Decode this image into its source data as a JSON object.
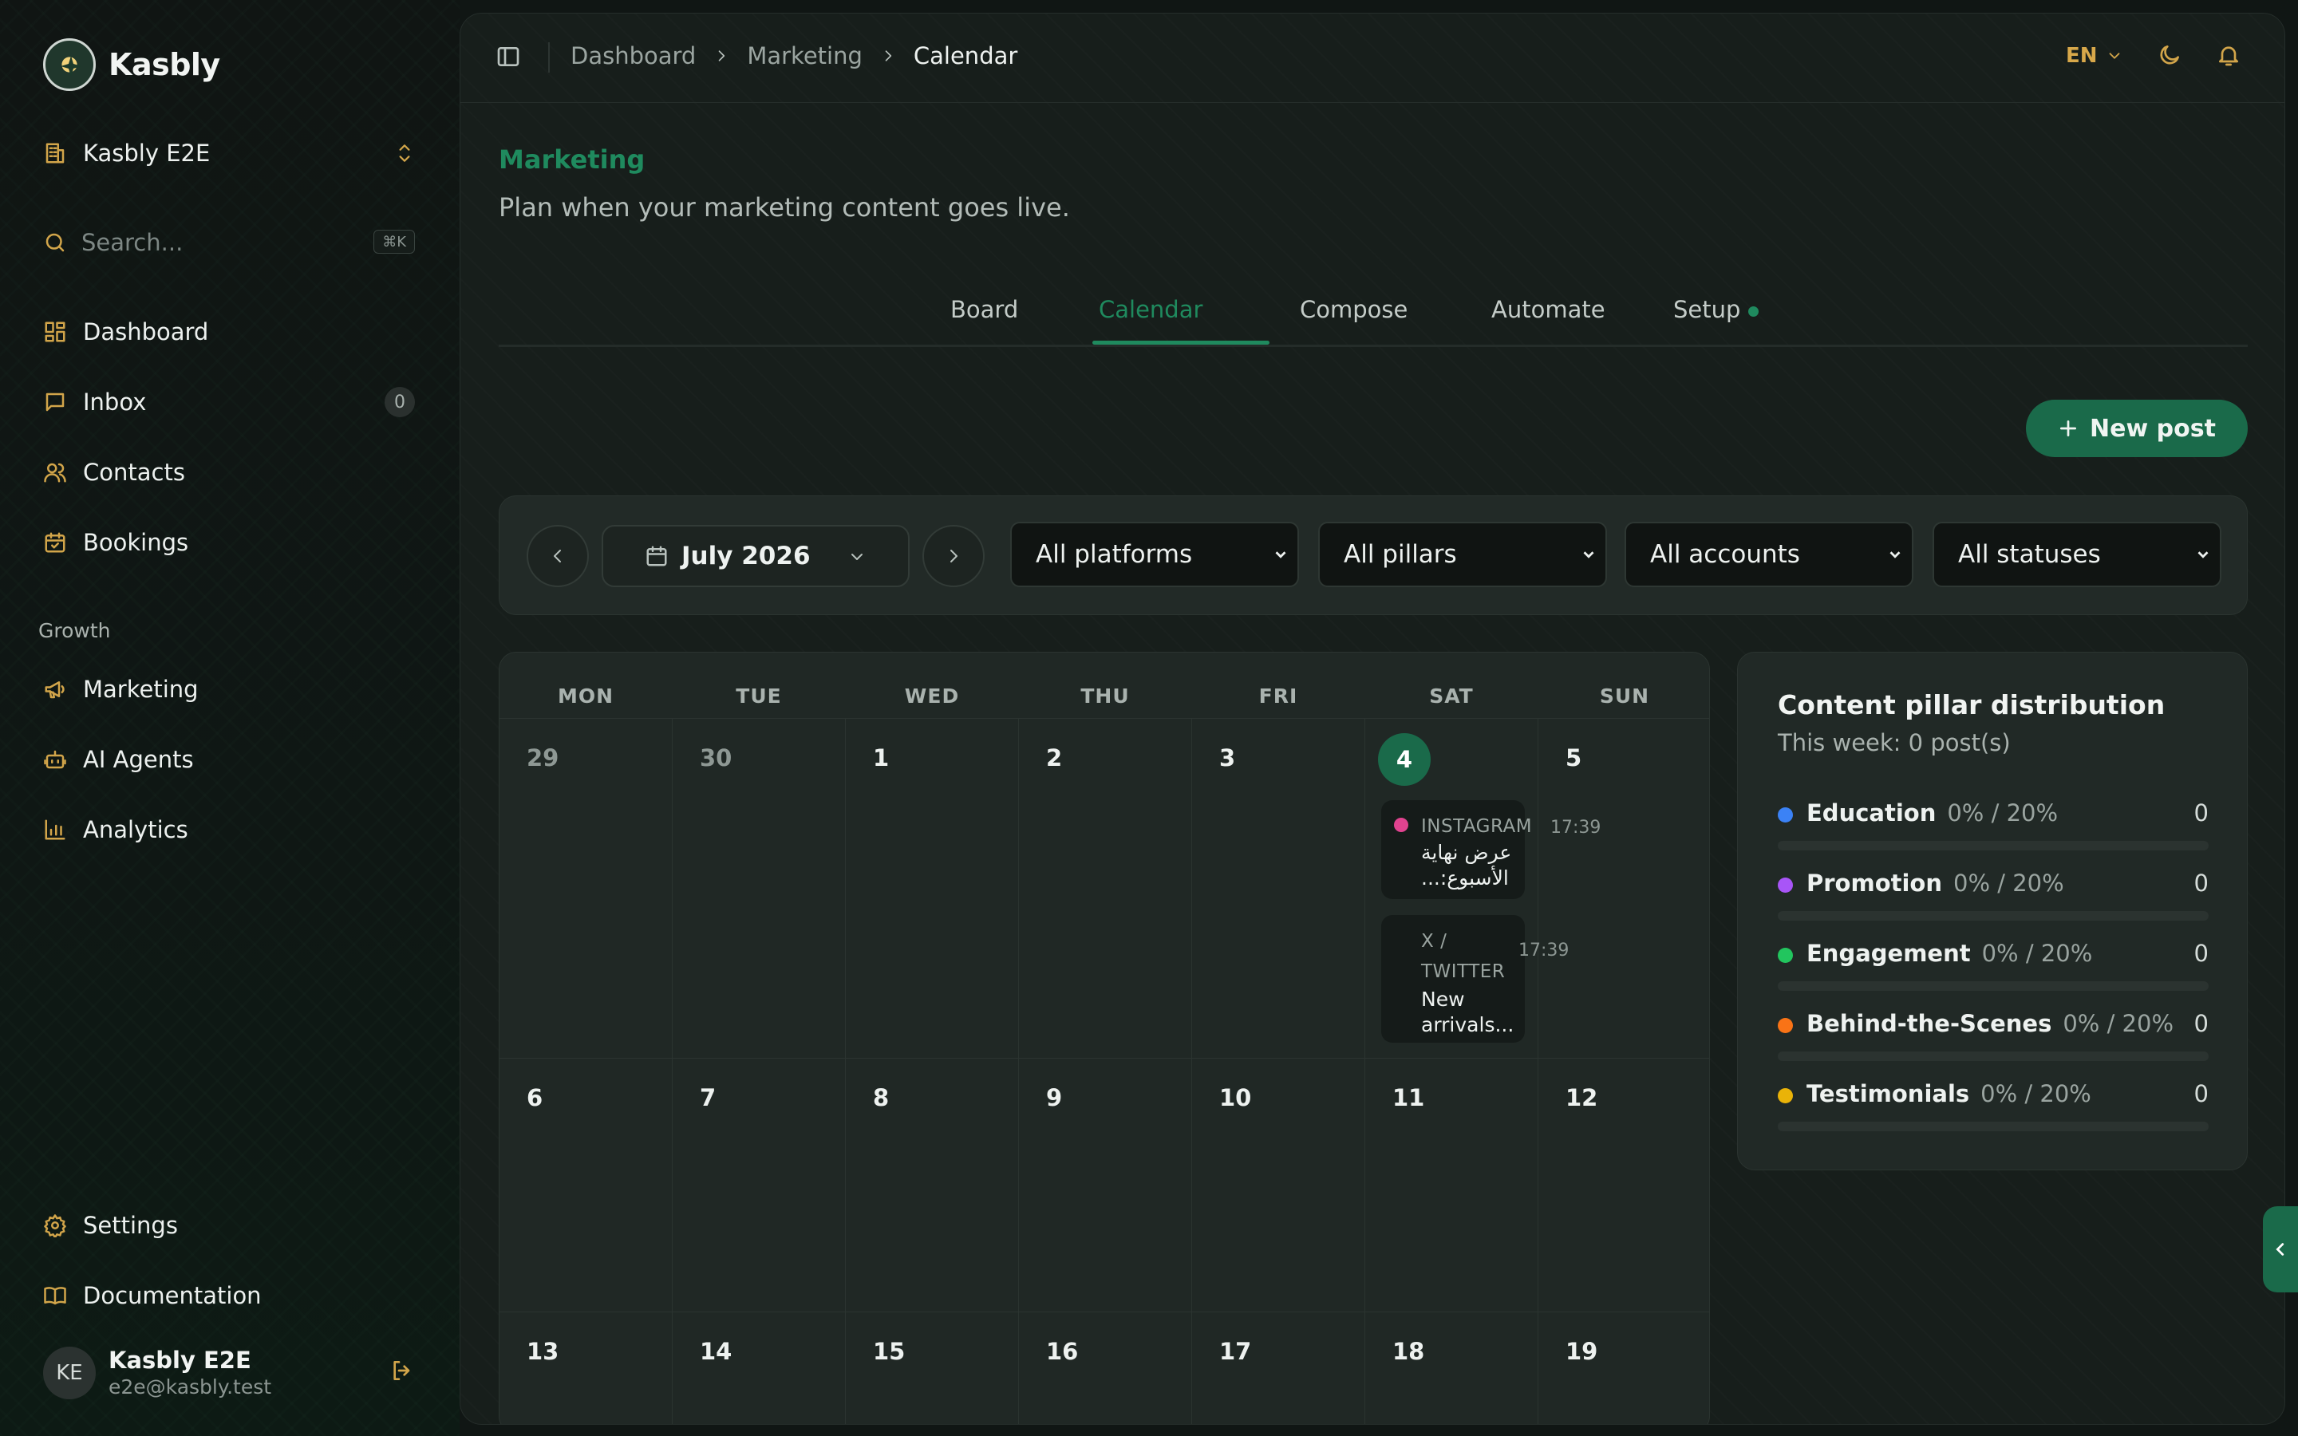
{
  "app": {
    "name": "Kasbly"
  },
  "org": {
    "name": "Kasbly E2E"
  },
  "search": {
    "placeholder": "Search...",
    "shortcut": "⌘K"
  },
  "sidebar": {
    "items": [
      {
        "label": "Dashboard",
        "icon": "dashboard-icon"
      },
      {
        "label": "Inbox",
        "icon": "inbox-icon",
        "badge": "0"
      },
      {
        "label": "Contacts",
        "icon": "contacts-icon"
      },
      {
        "label": "Bookings",
        "icon": "calendar-check-icon"
      }
    ],
    "section_label": "Growth",
    "growth_items": [
      {
        "label": "Marketing",
        "icon": "megaphone-icon"
      },
      {
        "label": "AI Agents",
        "icon": "bot-icon"
      },
      {
        "label": "Analytics",
        "icon": "bar-chart-icon"
      }
    ],
    "footer_items": [
      {
        "label": "Settings",
        "icon": "gear-icon"
      },
      {
        "label": "Documentation",
        "icon": "book-icon"
      }
    ],
    "user": {
      "initials": "KE",
      "name": "Kasbly E2E",
      "email": "e2e@kasbly.test"
    }
  },
  "topbar": {
    "breadcrumbs": [
      "Dashboard",
      "Marketing",
      "Calendar"
    ],
    "language": "EN"
  },
  "page": {
    "title": "Marketing",
    "subtitle": "Plan when your marketing content goes live."
  },
  "tabs": [
    {
      "label": "Board",
      "active": false
    },
    {
      "label": "Calendar",
      "active": true
    },
    {
      "label": "Compose",
      "active": false
    },
    {
      "label": "Automate",
      "active": false
    },
    {
      "label": "Setup",
      "active": false,
      "dot": true
    }
  ],
  "actions": {
    "new_post": "New post"
  },
  "filters": {
    "month": "July 2026",
    "platforms": "All platforms",
    "pillars": "All pillars",
    "accounts": "All accounts",
    "statuses": "All statuses"
  },
  "calendar": {
    "weekdays": [
      "MON",
      "TUE",
      "WED",
      "THU",
      "FRI",
      "SAT",
      "SUN"
    ],
    "weeks": [
      [
        "29",
        "30",
        "1",
        "2",
        "3",
        "4",
        "5"
      ],
      [
        "6",
        "7",
        "8",
        "9",
        "10",
        "11",
        "12"
      ],
      [
        "13",
        "14",
        "15",
        "16",
        "17",
        "18",
        "19"
      ]
    ],
    "today": "4",
    "events": [
      {
        "platform": "INSTAGRAM",
        "time": "17:39",
        "text": "عرض نهاية الأسبوع:...",
        "dot_color": "#e0438f"
      },
      {
        "platform": "X / TWITTER",
        "time": "17:39",
        "text": "New arrivals..."
      }
    ]
  },
  "pillar_card": {
    "title": "Content pillar distribution",
    "subtitle": "This week: 0 post(s)",
    "rows": [
      {
        "name": "Education",
        "pct": "0% / 20%",
        "count": "0",
        "color": "#3b82f6",
        "fill": 0
      },
      {
        "name": "Promotion",
        "pct": "0% / 20%",
        "count": "0",
        "color": "#a855f7",
        "fill": 0
      },
      {
        "name": "Engagement",
        "pct": "0% / 20%",
        "count": "0",
        "color": "#22c55e",
        "fill": 0
      },
      {
        "name": "Behind-the-Scenes",
        "pct": "0% / 20%",
        "count": "0",
        "color": "#f97316",
        "fill": 0
      },
      {
        "name": "Testimonials",
        "pct": "0% / 20%",
        "count": "0",
        "color": "#eab308",
        "fill": 0
      }
    ]
  },
  "colors": {
    "accent": "#1a6a4a",
    "accent_text": "#1f8a5e",
    "icon_gold": "#d2a54a"
  }
}
